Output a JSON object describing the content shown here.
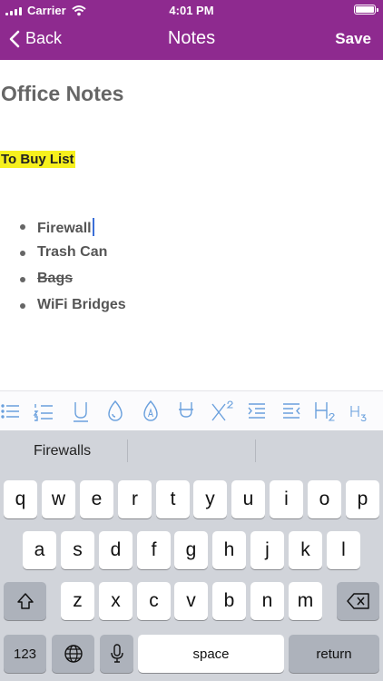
{
  "status_bar": {
    "carrier": "Carrier",
    "time": "4:01 PM"
  },
  "nav": {
    "back_label": "Back",
    "title": "Notes",
    "save_label": "Save"
  },
  "document": {
    "title": "Office Notes",
    "highlight": "To Buy List",
    "bullets": [
      "Firewall",
      "Trash Can",
      "Bags",
      "WiFi Bridges"
    ]
  },
  "toolbar": {
    "tools": [
      "bullet-list-icon",
      "numbered-list-icon",
      "underline-icon",
      "text-color-icon",
      "highlight-icon",
      "union-icon",
      "superscript-icon",
      "indent-icon",
      "outdent-icon",
      "heading-2-icon",
      "heading-3-icon"
    ],
    "accent_color": "#6aa0dd"
  },
  "keyboard": {
    "suggestion": "Firewalls",
    "row1": [
      "q",
      "w",
      "e",
      "r",
      "t",
      "y",
      "u",
      "i",
      "o",
      "p"
    ],
    "row2": [
      "a",
      "s",
      "d",
      "f",
      "g",
      "h",
      "j",
      "k",
      "l"
    ],
    "row3": [
      "z",
      "x",
      "c",
      "v",
      "b",
      "n",
      "m"
    ],
    "numbers_label": "123",
    "space_label": "space",
    "return_label": "return"
  },
  "colors": {
    "brand": "#8e2a8f",
    "highlight": "#f6f01d",
    "caret": "#3b6fd8"
  }
}
